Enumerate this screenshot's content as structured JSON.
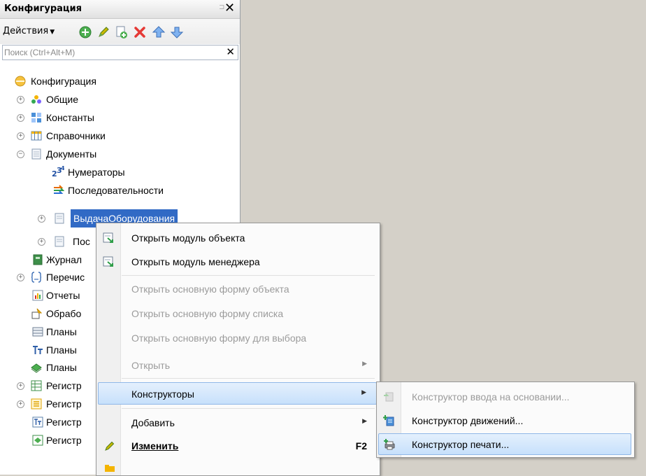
{
  "panel": {
    "title": "Конфигурация",
    "pin_glyph": "⊐",
    "close_glyph": "✕"
  },
  "toolbar": {
    "actions_label": "Действия",
    "actions_caret": "▼",
    "icons": [
      "add-icon",
      "edit-pencil-icon",
      "copy-icon",
      "delete-icon",
      "move-up-icon",
      "move-down-icon"
    ]
  },
  "search": {
    "placeholder": "Поиск (Ctrl+Alt+M)",
    "value": "",
    "clear_glyph": "✕"
  },
  "tree": {
    "items": [
      {
        "label": "Конфигурация"
      },
      {
        "label": "Общие",
        "expander": "+"
      },
      {
        "label": "Константы",
        "expander": "+"
      },
      {
        "label": "Справочники",
        "expander": "+"
      },
      {
        "label": "Документы",
        "expander": "−"
      },
      {
        "label": "Нумераторы"
      },
      {
        "label": "Последовательности"
      },
      {
        "label": "ВыдачаОборудования",
        "expander": "+"
      },
      {
        "label": "Пос",
        "expander": "+"
      },
      {
        "label": "Журнал"
      },
      {
        "label": "Перечис",
        "expander": "+"
      },
      {
        "label": "Отчеты"
      },
      {
        "label": "Обрабо"
      },
      {
        "label": "Планы"
      },
      {
        "label": "Планы"
      },
      {
        "label": "Планы"
      },
      {
        "label": "Регистр",
        "expander": "+"
      },
      {
        "label": "Регистр",
        "expander": "+"
      },
      {
        "label": "Регистр"
      },
      {
        "label": "Регистр"
      }
    ]
  },
  "menu": {
    "items": [
      {
        "label": "Открыть модуль объекта",
        "enabled": true
      },
      {
        "label": "Открыть модуль менеджера",
        "enabled": true
      },
      {
        "label": "Открыть основную форму объекта",
        "enabled": false
      },
      {
        "label": "Открыть основную форму списка",
        "enabled": false
      },
      {
        "label": "Открыть основную форму для выбора",
        "enabled": false
      },
      {
        "label": "Открыть",
        "enabled": false,
        "arrow": "▶"
      },
      {
        "label": "Конструкторы",
        "enabled": true,
        "arrow": "▶"
      },
      {
        "label": "Добавить",
        "enabled": true,
        "arrow": "▶"
      },
      {
        "label": "Изменить",
        "enabled": true,
        "shortcut": "F2"
      }
    ]
  },
  "submenu": {
    "items": [
      {
        "label": "Конструктор ввода на основании...",
        "enabled": false
      },
      {
        "label": "Конструктор движений...",
        "enabled": true
      },
      {
        "label": "Конструктор печати...",
        "enabled": true
      }
    ]
  },
  "colors": {
    "selection": "#316ac5",
    "highlight": "#c7e0fb",
    "workspace": "#d4d0c8"
  }
}
